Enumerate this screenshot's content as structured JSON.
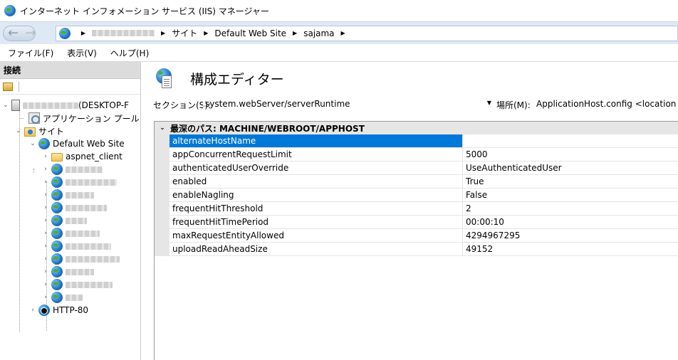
{
  "window": {
    "title": "インターネット インフォメーション サービス (IIS) マネージャー"
  },
  "address": {
    "crumbs": [
      "サイト",
      "Default Web Site",
      "sajama"
    ]
  },
  "menu": {
    "items": [
      "ファイル(F)",
      "表示(V)",
      "ヘルプ(H)"
    ]
  },
  "connections": {
    "header": "接続",
    "server_suffix": "(DESKTOP-F",
    "app_pools": "アプリケーション プール",
    "sites": "サイト",
    "default_site": "Default Web Site",
    "aspnet": "aspnet_client",
    "http80": "HTTP-80"
  },
  "editor": {
    "title": "構成エディター",
    "section_label": "セクション(S):",
    "section_value": "system.webServer/serverRuntime",
    "location_label": "場所(M):",
    "location_value": "ApplicationHost.config <location path",
    "group_header": "最深のパス: MACHINE/WEBROOT/APPHOST",
    "properties": [
      {
        "name": "alternateHostName",
        "value": ""
      },
      {
        "name": "appConcurrentRequestLimit",
        "value": "5000"
      },
      {
        "name": "authenticatedUserOverride",
        "value": "UseAuthenticatedUser"
      },
      {
        "name": "enabled",
        "value": "True"
      },
      {
        "name": "enableNagling",
        "value": "False"
      },
      {
        "name": "frequentHitThreshold",
        "value": "2"
      },
      {
        "name": "frequentHitTimePeriod",
        "value": "00:00:10"
      },
      {
        "name": "maxRequestEntityAllowed",
        "value": "4294967295"
      },
      {
        "name": "uploadReadAheadSize",
        "value": "49152"
      }
    ]
  },
  "colors": {
    "selection": "#0078d7",
    "address_bar": "#dfe9f5"
  }
}
